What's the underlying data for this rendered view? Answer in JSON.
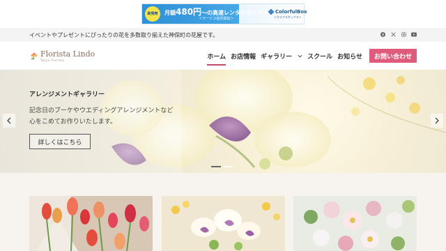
{
  "ad": {
    "badge": "新発売",
    "title_prefix": "月額",
    "title_price": "480円",
    "title_suffix": "〜の高速レンタルサーバー",
    "sub": "＜サービス提供開始＞",
    "brand": "ColorfulBox",
    "brand_sub": "＜カラフルボックス＞"
  },
  "topbar": {
    "text": "イベントやプレゼントにぴったりの花を多数取り揃えた神保町の花屋です。",
    "social": [
      "facebook-icon",
      "x-icon",
      "instagram-icon",
      "youtube-icon"
    ]
  },
  "header": {
    "logo_name": "Florista Lindo",
    "logo_sub": "Tokyo Florista",
    "nav": [
      {
        "label": "ホーム",
        "active": true
      },
      {
        "label": "お店情報"
      },
      {
        "label": "ギャラリー",
        "has_dropdown": true
      },
      {
        "label": "スクール"
      },
      {
        "label": "お知らせ"
      }
    ],
    "cta": "お問い合わせ"
  },
  "hero": {
    "title": "アレンジメントギャラリー",
    "line1": "記念日のブーケやウエディングアレンジメントなど",
    "line2": "心をこめてお作りいたします。",
    "button": "詳しくはこちら",
    "slides": 2,
    "active_slide": 0
  },
  "colors": {
    "accent": "#de5b7c",
    "nav_underline": "#c24b69",
    "topbar_bg": "#f4f4f4"
  }
}
